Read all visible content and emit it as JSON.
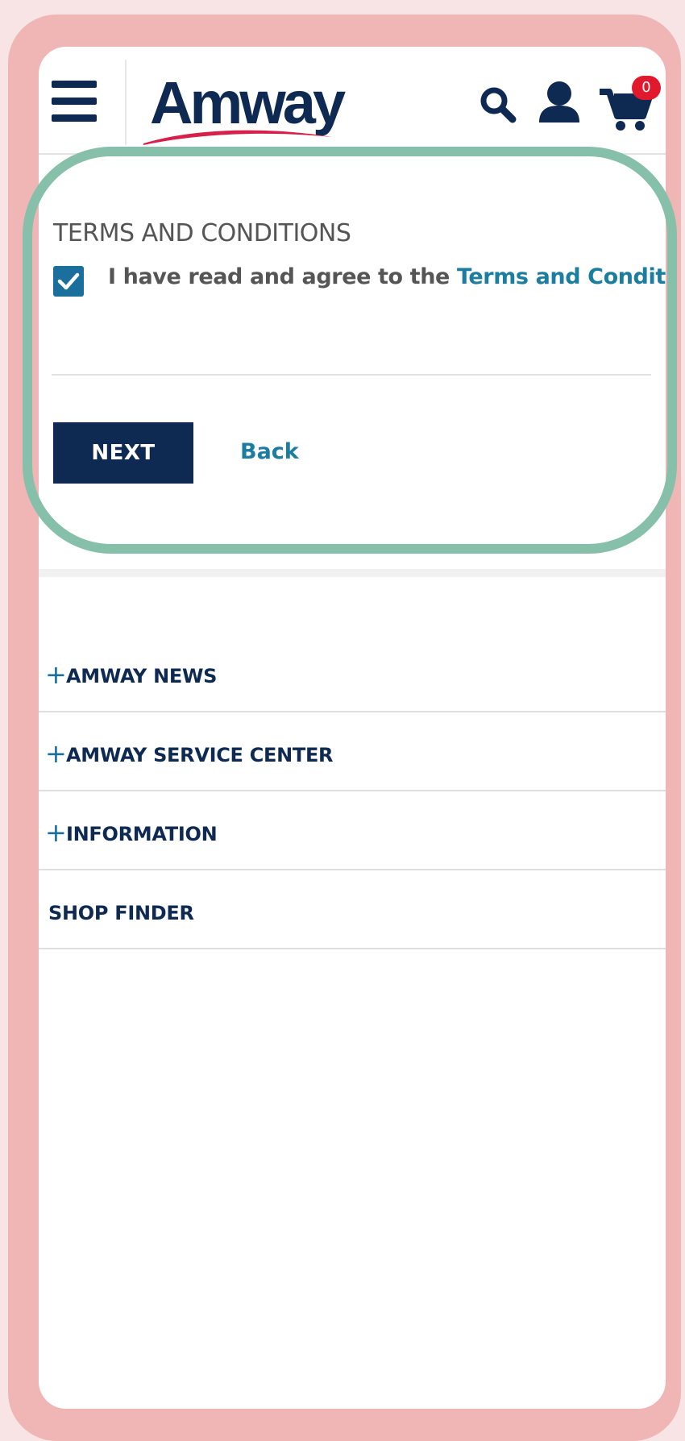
{
  "header": {
    "logo_text": "Amway",
    "cart_count": "0",
    "colors": {
      "brand_navy": "#0e2a53",
      "accent_red": "#e0192c",
      "link_teal": "#1b7da0"
    }
  },
  "terms": {
    "title": "TERMS AND CONDITIONS",
    "agree_prefix": "I have read and agree to the ",
    "agree_link": "Terms and Conditions",
    "checked": true
  },
  "actions": {
    "next_label": "NEXT",
    "back_label": "Back"
  },
  "footer": {
    "items": [
      {
        "label": "AMWAY NEWS",
        "expandable": true
      },
      {
        "label": "AMWAY SERVICE CENTER",
        "expandable": true
      },
      {
        "label": "INFORMATION",
        "expandable": true
      },
      {
        "label": "SHOP FINDER",
        "expandable": false
      }
    ],
    "expand_symbol": "+"
  }
}
